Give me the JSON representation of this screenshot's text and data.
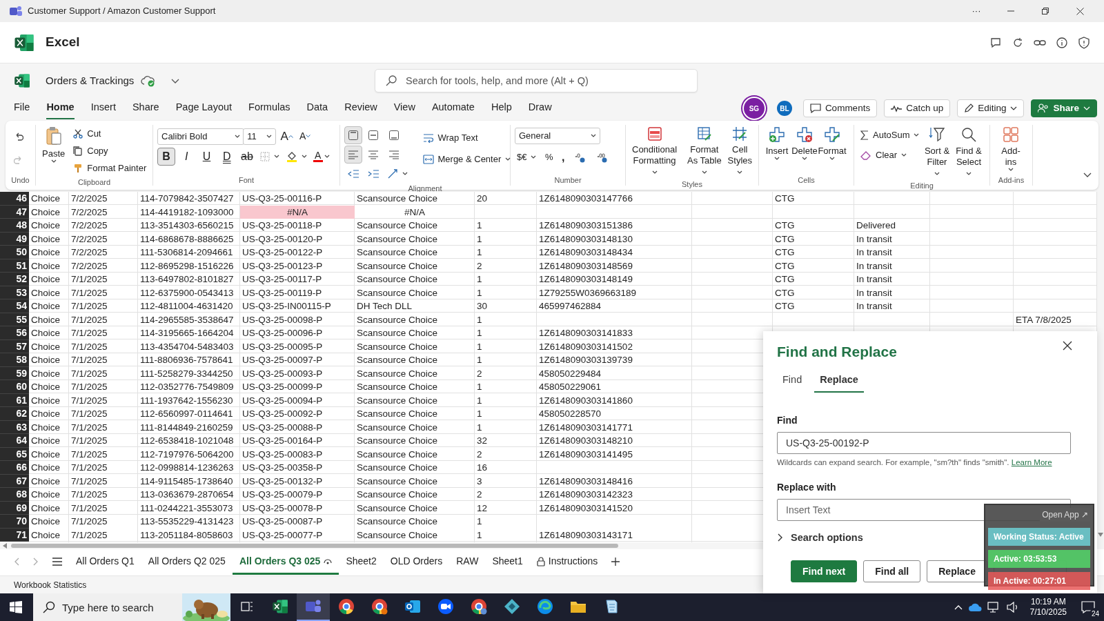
{
  "title_bar": {
    "title": "Customer Support / Amazon Customer Support",
    "more": "···"
  },
  "app": {
    "name": "Excel",
    "document": "Orders & Trackings"
  },
  "search": {
    "placeholder": "Search for tools, help, and more (Alt + Q)"
  },
  "menu": [
    {
      "label": "File",
      "selected": false
    },
    {
      "label": "Home",
      "selected": true
    },
    {
      "label": "Insert",
      "selected": false
    },
    {
      "label": "Share",
      "selected": false
    },
    {
      "label": "Page Layout",
      "selected": false
    },
    {
      "label": "Formulas",
      "selected": false
    },
    {
      "label": "Data",
      "selected": false
    },
    {
      "label": "Review",
      "selected": false
    },
    {
      "label": "View",
      "selected": false
    },
    {
      "label": "Automate",
      "selected": false
    },
    {
      "label": "Help",
      "selected": false
    },
    {
      "label": "Draw",
      "selected": false
    }
  ],
  "collaborators": [
    {
      "initials": "SG",
      "color": "#7b1fa2"
    },
    {
      "initials": "BL",
      "color": "#0f6cbd"
    }
  ],
  "header_buttons": [
    "Comments",
    "Catch up",
    "Editing",
    "Share"
  ],
  "ribbon": {
    "undo": {
      "label": "Undo",
      "redo_disabled": true
    },
    "clipboard": {
      "label": "Clipboard",
      "paste": "Paste",
      "commands": [
        "Cut",
        "Copy",
        "Format Painter"
      ]
    },
    "font": {
      "label": "Font",
      "name": "Calibri Bold",
      "size": "11",
      "grow": "A",
      "shrink": "A",
      "color_letter": "A",
      "styles": [
        {
          "label": "B",
          "selected": true
        },
        {
          "label": "I",
          "selected": false
        },
        {
          "label": "U",
          "selected": false
        },
        {
          "label": "D",
          "selected": false
        },
        {
          "label": "ab",
          "selected": false
        }
      ]
    },
    "alignment": {
      "label": "Alignment",
      "vertical": [
        {
          "selected": true
        },
        {
          "selected": false
        },
        {
          "selected": false
        }
      ],
      "horizontal": [
        {
          "selected": true
        },
        {
          "selected": false
        },
        {
          "selected": false
        }
      ],
      "commands": [
        "Wrap Text",
        "Merge & Center"
      ]
    },
    "number": {
      "label": "Number",
      "format": "General",
      "currency": "$€",
      "percent": "%",
      "comma": ","
    },
    "styles": {
      "label": "Styles",
      "commands": [
        "Conditional Formatting",
        "Format As Table",
        "Cell Styles"
      ]
    },
    "cells": {
      "label": "Cells",
      "commands": [
        "Insert",
        "Delete",
        "Format"
      ]
    },
    "editing": {
      "label": "Editing",
      "commands": [
        "AutoSum",
        "Clear",
        "Sort & Filter",
        "Find & Select"
      ]
    },
    "addins": {
      "label": "Add-ins",
      "command": "Add-ins"
    }
  },
  "rows": [
    {
      "number": "46",
      "error": false,
      "cells": {
        "A": "Choice",
        "B": "7/2/2025",
        "C": "114-7079842-3507427",
        "D": "US-Q3-25-00116-P",
        "E": "Scansource Choice",
        "F": "20",
        "G": "1Z6148090303147766",
        "I": "CTG"
      }
    },
    {
      "number": "47",
      "error": true,
      "cells": {
        "A": "Choice",
        "B": "7/2/2025",
        "C": "114-4419182-1093000",
        "D": "#N/A",
        "E": "#N/A"
      }
    },
    {
      "number": "48",
      "error": false,
      "cells": {
        "A": "Choice",
        "B": "7/2/2025",
        "C": "113-3514303-6560215",
        "D": "US-Q3-25-00118-P",
        "E": "Scansource Choice",
        "F": "1",
        "G": "1Z6148090303151386",
        "I": "CTG",
        "J": "Delivered"
      }
    },
    {
      "number": "49",
      "error": false,
      "cells": {
        "A": "Choice",
        "B": "7/2/2025",
        "C": "114-6868678-8886625",
        "D": "US-Q3-25-00120-P",
        "E": "Scansource Choice",
        "F": "1",
        "G": "1Z6148090303148130",
        "I": "CTG",
        "J": "In transit"
      }
    },
    {
      "number": "50",
      "error": false,
      "cells": {
        "A": "Choice",
        "B": "7/2/2025",
        "C": "111-5306814-2094661",
        "D": "US-Q3-25-00122-P",
        "E": "Scansource Choice",
        "F": "1",
        "G": "1Z6148090303148434",
        "I": "CTG",
        "J": "In transit"
      }
    },
    {
      "number": "51",
      "error": false,
      "cells": {
        "A": "Choice",
        "B": "7/2/2025",
        "C": "112-8695298-1516226",
        "D": "US-Q3-25-00123-P",
        "E": "Scansource Choice",
        "F": "2",
        "G": "1Z6148090303148569",
        "I": "CTG",
        "J": "In transit"
      }
    },
    {
      "number": "52",
      "error": false,
      "cells": {
        "A": "Choice",
        "B": "7/1/2025",
        "C": "113-6497802-8101827",
        "D": "US-Q3-25-00117-P",
        "E": "Scansource Choice",
        "F": "1",
        "G": "1Z6148090303148149",
        "I": "CTG",
        "J": "In transit"
      }
    },
    {
      "number": "53",
      "error": false,
      "cells": {
        "A": "Choice",
        "B": "7/1/2025",
        "C": "112-6375900-0543413",
        "D": "US-Q3-25-00119-P",
        "E": "Scansource Choice",
        "F": "1",
        "G": "1Z79255W0369663189",
        "I": "CTG",
        "J": "In transit"
      }
    },
    {
      "number": "54",
      "error": false,
      "cells": {
        "A": "Choice",
        "B": "7/1/2025",
        "C": "112-4811004-4631420",
        "D": "US-Q3-25-IN00115-P",
        "E": "DH Tech DLL",
        "F": "30",
        "G": "465997462884",
        "I": "CTG",
        "J": "In transit"
      }
    },
    {
      "number": "55",
      "error": false,
      "cells": {
        "A": "Choice",
        "B": "7/1/2025",
        "C": "114-2965585-3538647",
        "D": "US-Q3-25-00098-P",
        "E": "Scansource Choice",
        "F": "1",
        "L": "ETA 7/8/2025"
      }
    },
    {
      "number": "56",
      "error": false,
      "cells": {
        "A": "Choice",
        "B": "7/1/2025",
        "C": "114-3195665-1664204",
        "D": "US-Q3-25-00096-P",
        "E": "Scansource Choice",
        "F": "1",
        "G": "1Z6148090303141833"
      }
    },
    {
      "number": "57",
      "error": false,
      "cells": {
        "A": "Choice",
        "B": "7/1/2025",
        "C": "113-4354704-5483403",
        "D": "US-Q3-25-00095-P",
        "E": "Scansource Choice",
        "F": "1",
        "G": "1Z6148090303141502"
      }
    },
    {
      "number": "58",
      "error": false,
      "cells": {
        "A": "Choice",
        "B": "7/1/2025",
        "C": "111-8806936-7578641",
        "D": "US-Q3-25-00097-P",
        "E": "Scansource Choice",
        "F": "1",
        "G": "1Z6148090303139739"
      }
    },
    {
      "number": "59",
      "error": false,
      "cells": {
        "A": "Choice",
        "B": "7/1/2025",
        "C": "111-5258279-3344250",
        "D": "US-Q3-25-00093-P",
        "E": "Scansource Choice",
        "F": "2",
        "G": "458050229484"
      }
    },
    {
      "number": "60",
      "error": false,
      "cells": {
        "A": "Choice",
        "B": "7/1/2025",
        "C": "112-0352776-7549809",
        "D": "US-Q3-25-00099-P",
        "E": "Scansource Choice",
        "F": "1",
        "G": "458050229061"
      }
    },
    {
      "number": "61",
      "error": false,
      "cells": {
        "A": "Choice",
        "B": "7/1/2025",
        "C": "111-1937642-1556230",
        "D": "US-Q3-25-00094-P",
        "E": "Scansource Choice",
        "F": "1",
        "G": "1Z6148090303141860"
      }
    },
    {
      "number": "62",
      "error": false,
      "cells": {
        "A": "Choice",
        "B": "7/1/2025",
        "C": "112-6560997-0114641",
        "D": "US-Q3-25-00092-P",
        "E": "Scansource Choice",
        "F": "1",
        "G": "458050228570"
      }
    },
    {
      "number": "63",
      "error": false,
      "cells": {
        "A": "Choice",
        "B": "7/1/2025",
        "C": "111-8144849-2160259",
        "D": "US-Q3-25-00088-P",
        "E": "Scansource Choice",
        "F": "1",
        "G": "1Z6148090303141771"
      }
    },
    {
      "number": "64",
      "error": false,
      "cells": {
        "A": "Choice",
        "B": "7/1/2025",
        "C": "112-6538418-1021048",
        "D": "US-Q3-25-00164-P",
        "E": "Scansource Choice",
        "F": "32",
        "G": "1Z6148090303148210"
      }
    },
    {
      "number": "65",
      "error": false,
      "cells": {
        "A": "Choice",
        "B": "7/1/2025",
        "C": "112-7197976-5064200",
        "D": "US-Q3-25-00083-P",
        "E": "Scansource Choice",
        "F": "2",
        "G": "1Z6148090303141495"
      }
    },
    {
      "number": "66",
      "error": false,
      "cells": {
        "A": "Choice",
        "B": "7/1/2025",
        "C": "112-0998814-1236263",
        "D": "US-Q3-25-00358-P",
        "E": "Scansource Choice",
        "F": "16"
      }
    },
    {
      "number": "67",
      "error": false,
      "cells": {
        "A": "Choice",
        "B": "7/1/2025",
        "C": "114-9115485-1738640",
        "D": "US-Q3-25-00132-P",
        "E": "Scansource Choice",
        "F": "3",
        "G": "1Z6148090303148416"
      }
    },
    {
      "number": "68",
      "error": false,
      "cells": {
        "A": "Choice",
        "B": "7/1/2025",
        "C": "113-0363679-2870654",
        "D": "US-Q3-25-00079-P",
        "E": "Scansource Choice",
        "F": "2",
        "G": "1Z6148090303142323"
      }
    },
    {
      "number": "69",
      "error": false,
      "cells": {
        "A": "Choice",
        "B": "7/1/2025",
        "C": "111-0244221-3553073",
        "D": "US-Q3-25-00078-P",
        "E": "Scansource Choice",
        "F": "12",
        "G": "1Z6148090303141520"
      }
    },
    {
      "number": "70",
      "error": false,
      "cells": {
        "A": "Choice",
        "B": "7/1/2025",
        "C": "113-5535229-4131423",
        "D": "US-Q3-25-00087-P",
        "E": "Scansource Choice",
        "F": "1"
      }
    },
    {
      "number": "71",
      "error": false,
      "cells": {
        "A": "Choice",
        "B": "7/1/2025",
        "C": "113-2051184-8058603",
        "D": "US-Q3-25-00077-P",
        "E": "Scansource Choice",
        "F": "1",
        "G": "1Z6148090303143171"
      }
    }
  ],
  "sheet_tabs": [
    {
      "label": "All Orders Q1",
      "selected": false,
      "kind": "plain"
    },
    {
      "label": "All Orders Q2 025",
      "selected": false,
      "kind": "plain"
    },
    {
      "label": "All Orders Q3 025",
      "selected": true,
      "kind": "viewed"
    },
    {
      "label": "Sheet2",
      "selected": false,
      "kind": "plain"
    },
    {
      "label": "OLD Orders",
      "selected": false,
      "kind": "plain"
    },
    {
      "label": "RAW",
      "selected": false,
      "kind": "plain"
    },
    {
      "label": "Sheet1",
      "selected": false,
      "kind": "plain"
    },
    {
      "label": "Instructions",
      "selected": false,
      "kind": "locked"
    }
  ],
  "status_bar": {
    "text": "Workbook Statistics"
  },
  "find_replace": {
    "title": "Find and Replace",
    "tabs": [
      {
        "label": "Find",
        "selected": false
      },
      {
        "label": "Replace",
        "selected": true
      }
    ],
    "find_label": "Find",
    "find_value": "US-Q3-25-00192-P",
    "hint": "Wildcards can expand search. For example, \"sm?th\" finds \"smith\".",
    "hint_link": "Learn More",
    "replace_label": "Replace with",
    "replace_placeholder": "Insert Text",
    "search_options": {
      "label": "Search options",
      "expanded": false
    },
    "buttons": [
      "Find next",
      "Find all",
      "Replace"
    ],
    "covered_button": true
  },
  "status_widget": {
    "open_app": "Open App ↗",
    "status": "Working Status: Active",
    "active": "Active: 03:53:53",
    "inactive": "In Active: 00:27:01"
  },
  "taskbar": {
    "search_placeholder": "Type here to search",
    "apps": [
      {
        "selected": false
      },
      {
        "selected": false
      },
      {
        "selected": true
      },
      {
        "selected": false
      },
      {
        "selected": false
      },
      {
        "selected": false
      },
      {
        "selected": false
      },
      {
        "selected": false
      },
      {
        "selected": false
      },
      {
        "selected": false
      },
      {
        "selected": false
      },
      {
        "selected": false
      }
    ],
    "time": "10:19 AM",
    "date": "7/10/2025",
    "notifications": "24"
  }
}
